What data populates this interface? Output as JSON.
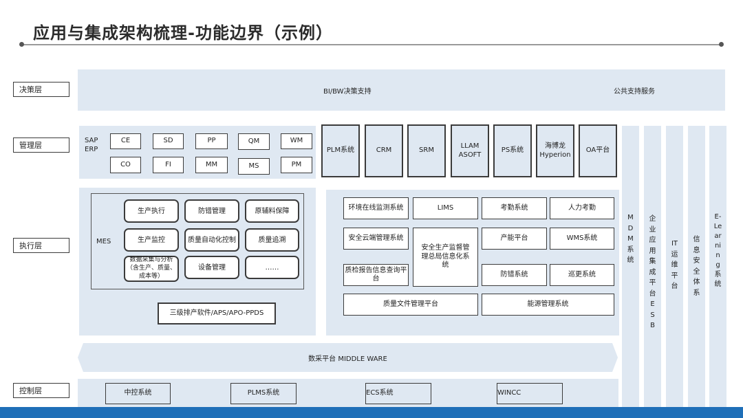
{
  "title": "应用与集成架构梳理-功能边界（示例）",
  "layers": {
    "decision": "决策层",
    "management": "管理层",
    "execution": "执行层",
    "control": "控制层"
  },
  "decision_band": {
    "bi": "BI/BW决策支持",
    "public": "公共支持服务"
  },
  "sap": {
    "label": "SAP ERP",
    "modules": [
      "CE",
      "SD",
      "PP",
      "QM",
      "WM",
      "CO",
      "FI",
      "MM",
      "MS",
      "PM"
    ]
  },
  "mgmt_systems": [
    "PLM系统",
    "CRM",
    "SRM",
    "LLAM ASOFT",
    "PS系统",
    "海博龙 Hyperion",
    "OA平台"
  ],
  "vertical_columns": [
    "MDM系统",
    "企业应用集成平台ESB",
    "IT运维平台",
    "信息安全体系",
    "E-Learning系统"
  ],
  "mes": {
    "label": "MES",
    "cells": [
      "生产执行",
      "防错管理",
      "原辅料保障",
      "生产监控",
      "质量自动化控制",
      "质量追溯",
      "数据采集与分析（含生产、质量、成本等）",
      "设备管理",
      "……"
    ],
    "aps": "三级排产软件/APS/APO-PPDS"
  },
  "exec_right": {
    "env": "环境在线监测系统",
    "lims": "LIMS",
    "attendance": "考勤系统",
    "hr_attendance": "人力考勤",
    "safety_cloud": "安全云端管理系统",
    "safety_central": "安全生产监督管理总局信息化系统",
    "capacity": "产能平台",
    "wms": "WMS系统",
    "qc_report": "质检报告信息查询平台",
    "anti_error": "防错系统",
    "patrol": "巡更系统",
    "quality_doc": "质量文件管理平台",
    "energy": "能源管理系统"
  },
  "middleware": "数采平台 MIDDLE WARE",
  "control_systems": [
    "中控系统",
    "PLMS系统",
    "ECS系统",
    "WINCC"
  ]
}
